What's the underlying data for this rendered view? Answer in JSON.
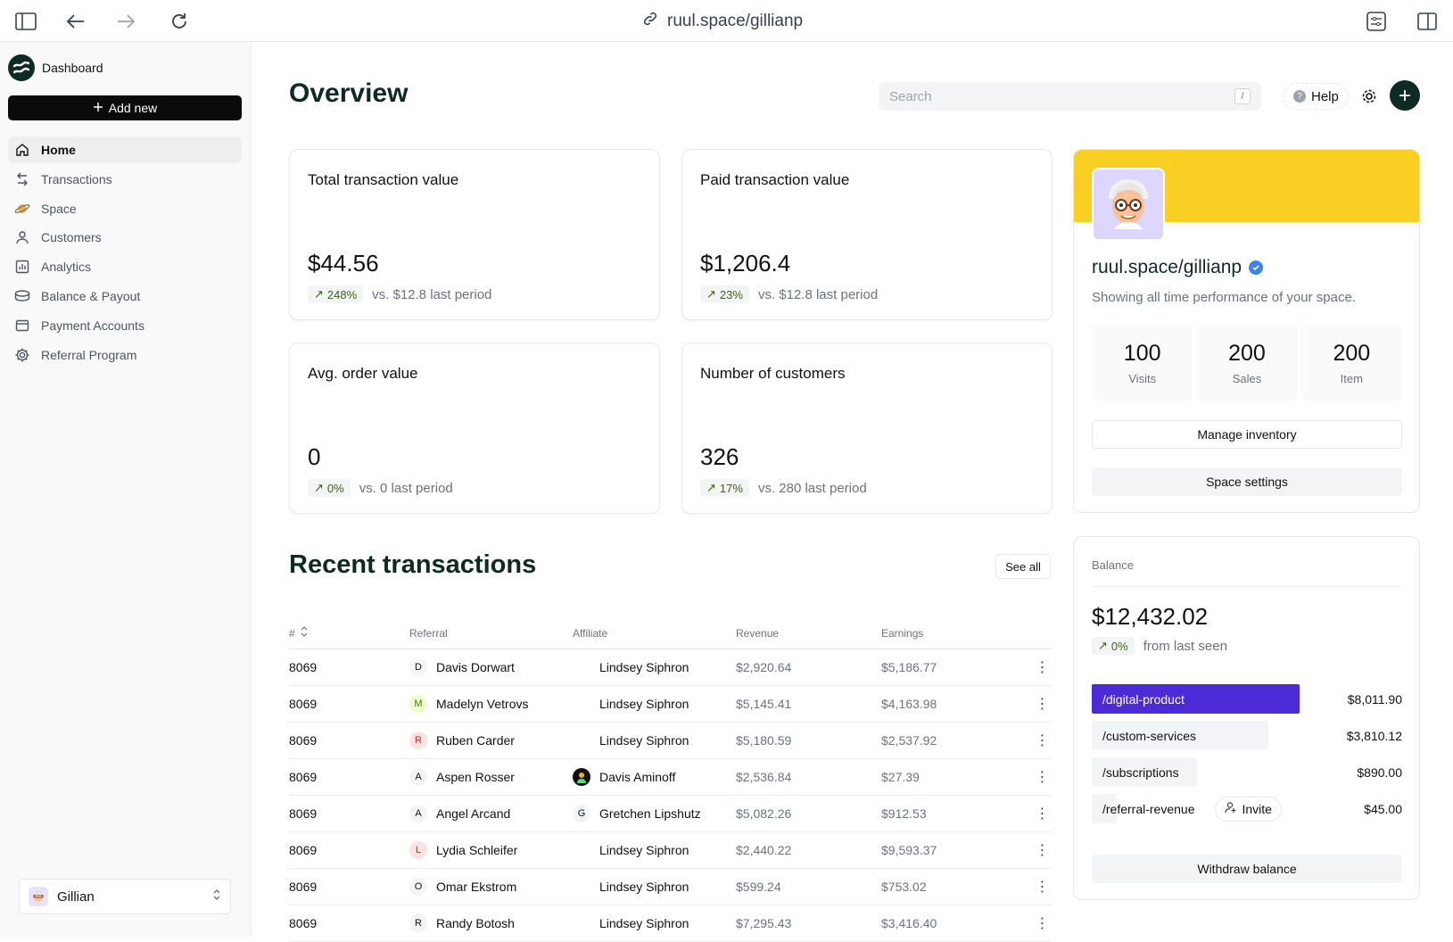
{
  "browser": {
    "url": "ruul.space/gillianp"
  },
  "sidebar": {
    "brand": "Dashboard",
    "add_new": "Add new",
    "items": [
      {
        "label": "Home",
        "icon": "home-icon"
      },
      {
        "label": "Transactions",
        "icon": "arrows-icon"
      },
      {
        "label": "Space",
        "icon": "planet-icon"
      },
      {
        "label": "Customers",
        "icon": "user-icon"
      },
      {
        "label": "Analytics",
        "icon": "chart-icon"
      },
      {
        "label": "Balance & Payout",
        "icon": "coins-icon"
      },
      {
        "label": "Payment Accounts",
        "icon": "wallet-icon"
      },
      {
        "label": "Referral Program",
        "icon": "gear-icon"
      }
    ],
    "user": "Gillian"
  },
  "header": {
    "title": "Overview",
    "search_placeholder": "Search",
    "search_kbd": "/",
    "help": "Help"
  },
  "cards": [
    {
      "label": "Total transaction value",
      "value": "$44.56",
      "pct": "248%",
      "cmp": "vs. $12.8 last period"
    },
    {
      "label": "Paid transaction value",
      "value": "$1,206.4",
      "pct": "23%",
      "cmp": "vs. $12.8 last period"
    },
    {
      "label": "Avg. order value",
      "value": "0",
      "pct": "0%",
      "cmp": "vs. 0 last period"
    },
    {
      "label": "Number of customers",
      "value": "326",
      "pct": "17%",
      "cmp": "vs. 280 last period"
    }
  ],
  "profile": {
    "name": "ruul.space/gillianp",
    "desc": "Showing all time performance of your space.",
    "stats": [
      {
        "num": "100",
        "label": "Visits"
      },
      {
        "num": "200",
        "label": "Sales"
      },
      {
        "num": "200",
        "label": "Item"
      }
    ],
    "manage": "Manage inventory",
    "settings": "Space settings"
  },
  "transactions": {
    "title": "Recent transactions",
    "see_all": "See all",
    "headers": [
      "#",
      "Referral",
      "Affiliate",
      "Revenue",
      "Earnings"
    ],
    "rows": [
      {
        "id": "8069",
        "ref_init": "D",
        "ref": "Davis Dorwart",
        "aff_init": "",
        "aff": "Lindsey Siphron",
        "rev": "$2,920.64",
        "earn": "$5,186.77"
      },
      {
        "id": "8069",
        "ref_init": "M",
        "ref": "Madelyn Vetrovs",
        "aff_init": "",
        "aff": "Lindsey Siphron",
        "rev": "$5,145.41",
        "earn": "$4,163.98"
      },
      {
        "id": "8069",
        "ref_init": "R",
        "ref": "Ruben Carder",
        "aff_init": "",
        "aff": "Lindsey Siphron",
        "rev": "$5,180.59",
        "earn": "$2,537.92"
      },
      {
        "id": "8069",
        "ref_init": "A",
        "ref": "Aspen Rosser",
        "aff_init": "avatar",
        "aff": "Davis Aminoff",
        "rev": "$2,536.84",
        "earn": "$27.39"
      },
      {
        "id": "8069",
        "ref_init": "A",
        "ref": "Angel Arcand",
        "aff_init": "G",
        "aff": "Gretchen Lipshutz",
        "rev": "$5,082.26",
        "earn": "$912.53"
      },
      {
        "id": "8069",
        "ref_init": "L",
        "ref": "Lydia Schleifer",
        "aff_init": "",
        "aff": "Lindsey Siphron",
        "rev": "$2,440.22",
        "earn": "$9,593.37"
      },
      {
        "id": "8069",
        "ref_init": "O",
        "ref": "Omar Ekstrom",
        "aff_init": "",
        "aff": "Lindsey Siphron",
        "rev": "$599.24",
        "earn": "$753.02"
      },
      {
        "id": "8069",
        "ref_init": "R",
        "ref": "Randy Botosh",
        "aff_init": "",
        "aff": "Lindsey Siphron",
        "rev": "$7,295.43",
        "earn": "$3,416.40"
      }
    ]
  },
  "balance": {
    "label": "Balance",
    "value": "$12,432.02",
    "pct": "0%",
    "cmp": "from last seen",
    "bars": [
      {
        "label": "/digital-product",
        "amount": "$8,011.90",
        "level": 0.67,
        "color": "#4c2bd6",
        "text_color": "#ffffff"
      },
      {
        "label": "/custom-services",
        "amount": "$3,810.12",
        "level": 0.57,
        "color": "#f3f4f6",
        "text_color": "#111111"
      },
      {
        "label": "/subscriptions",
        "amount": "$890.00",
        "level": 0.34,
        "color": "#f3f4f6",
        "text_color": "#111111"
      },
      {
        "label": "/referral-revenue",
        "amount": "$45.00",
        "level": 0.08,
        "color": "#f3f4f6",
        "text_color": "#111111",
        "invite": "Invite"
      }
    ],
    "withdraw": "Withdraw balance"
  },
  "colors": {
    "brand": "#0f2a24",
    "banner": "#f9cf24",
    "accent": "#4c2bd6"
  }
}
